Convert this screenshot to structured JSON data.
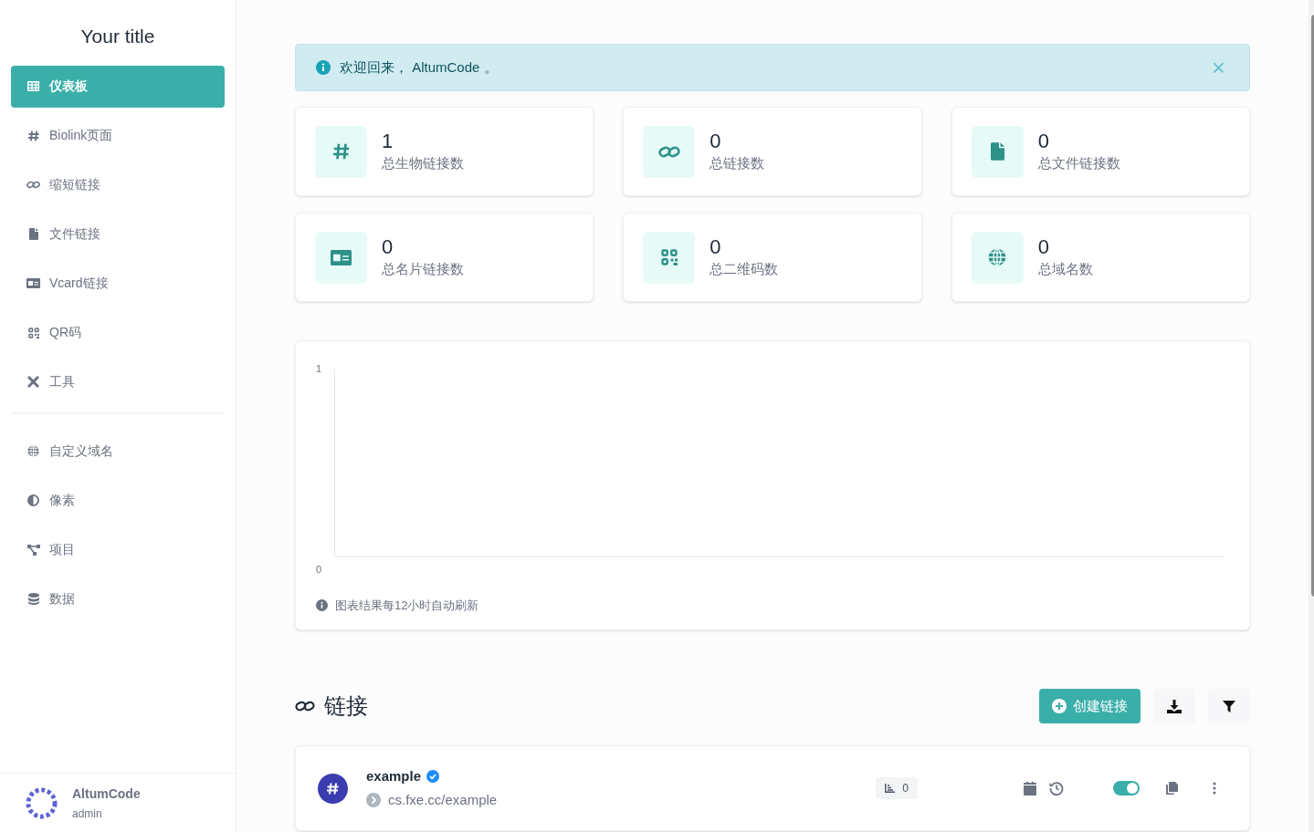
{
  "sidebar": {
    "title": "Your title",
    "groups": [
      {
        "items": [
          {
            "label": "仪表板",
            "selected": true
          },
          {
            "label": "Biolink页面",
            "selected": false
          },
          {
            "label": "缩短链接",
            "selected": false
          },
          {
            "label": "文件链接",
            "selected": false
          },
          {
            "label": "Vcard链接",
            "selected": false
          },
          {
            "label": "QR码",
            "selected": false
          },
          {
            "label": "工具",
            "selected": false
          }
        ]
      },
      {
        "items": [
          {
            "label": "自定义域名",
            "selected": false
          },
          {
            "label": "像素",
            "selected": false
          },
          {
            "label": "项目",
            "selected": false
          },
          {
            "label": "数据",
            "selected": false
          }
        ]
      }
    ],
    "user": {
      "name": "AltumCode",
      "role": "admin"
    }
  },
  "alert": {
    "text": "欢迎回来， AltumCode 。",
    "close": "×"
  },
  "stats": [
    {
      "value": "1",
      "label": "总生物链接数"
    },
    {
      "value": "0",
      "label": "总链接数"
    },
    {
      "value": "0",
      "label": "总文件链接数"
    },
    {
      "value": "0",
      "label": "总名片链接数"
    },
    {
      "value": "0",
      "label": "总二维码数"
    },
    {
      "value": "0",
      "label": "总域名数"
    }
  ],
  "chart": {
    "y_axis_labels": [
      "1",
      "0"
    ],
    "note": "图表结果每12小时自动刷新"
  },
  "links_section": {
    "title": "链接",
    "create_button": "创建链接",
    "links": [
      {
        "name": "example",
        "verified": true,
        "url": "cs.fxe.cc/example",
        "clicks": "0",
        "enabled": true
      }
    ]
  }
}
